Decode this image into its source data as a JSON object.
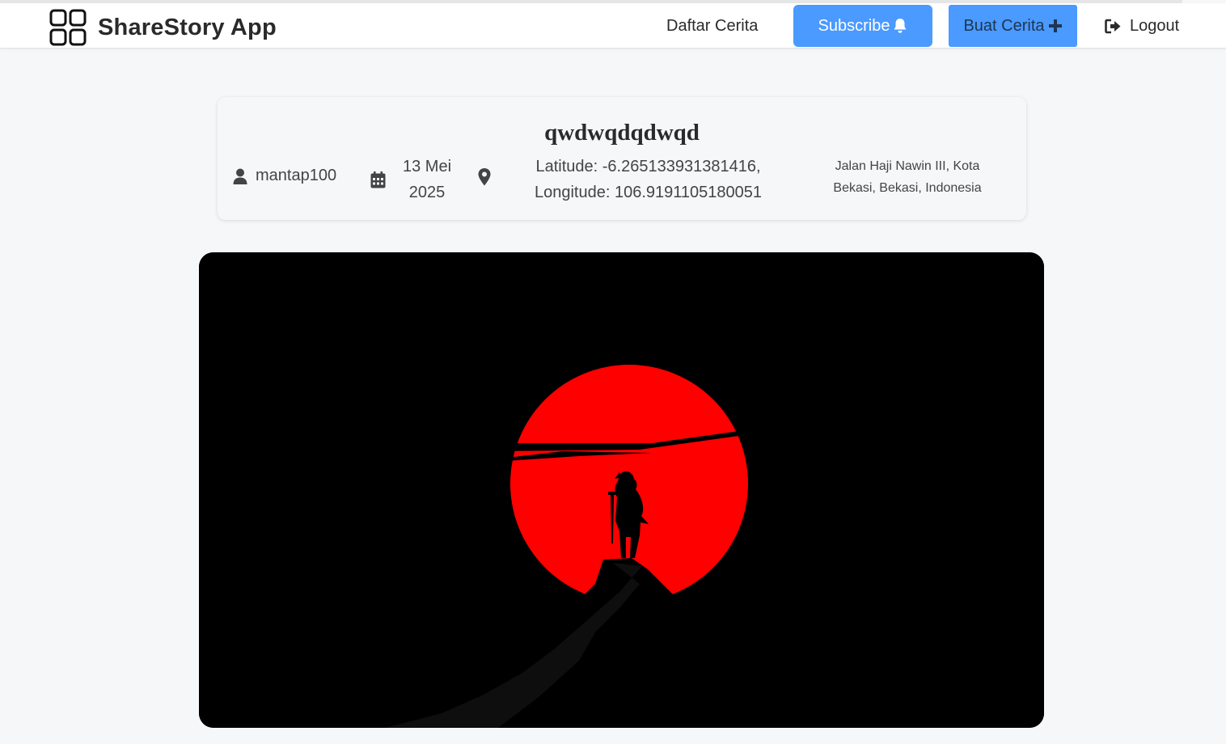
{
  "navbar": {
    "brand_name": "ShareStory App",
    "links": {
      "daftar_cerita": "Daftar Cerita",
      "subscribe": "Subscribe",
      "buat_cerita": "Buat Cerita",
      "logout": "Logout"
    },
    "accent_color": "#4a9aff"
  },
  "story": {
    "title": "qwdwqdqdwqd",
    "author": "mantap100",
    "date_line1": "13 Mei",
    "date_line2": "2025",
    "latitude_text": "Latitude: -6.265133931381416,",
    "longitude_text": "Longitude: 106.9191105180051",
    "address_line1": "Jalan Haji Nawin III, Kota",
    "address_line2": "Bekasi, Bekasi, Indonesia"
  },
  "icons": {
    "brand": "grid-icon",
    "subscribe": "bell-icon",
    "buat_cerita": "plus-icon",
    "logout": "logout-icon",
    "author": "user-icon",
    "date": "calendar-icon",
    "location": "map-pin-icon"
  },
  "image": {
    "background": "#000000",
    "sun_color": "#ff0000"
  }
}
